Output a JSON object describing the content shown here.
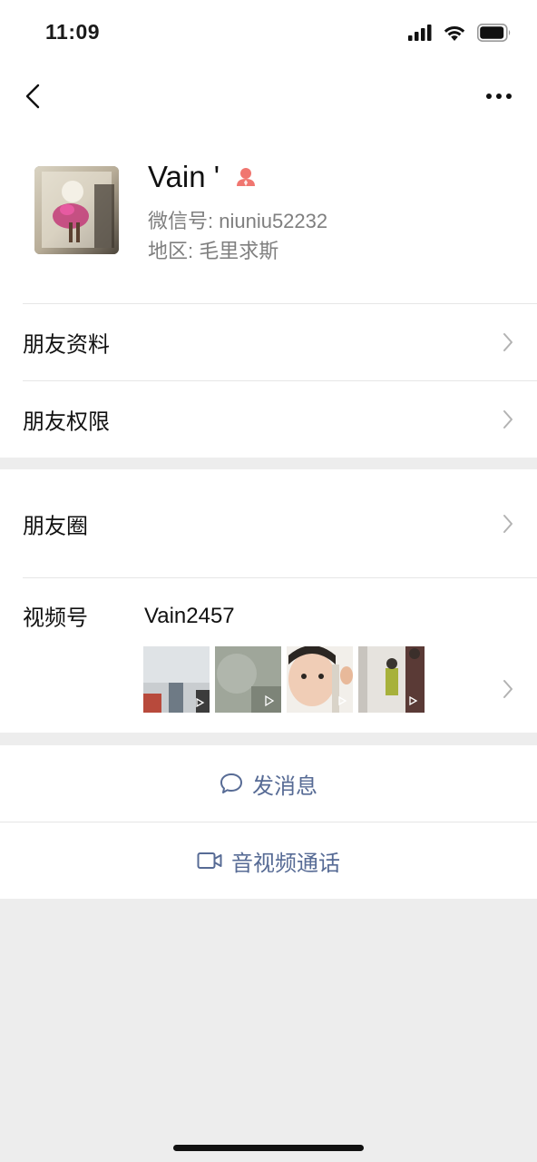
{
  "status_bar": {
    "time": "11:09"
  },
  "profile": {
    "name": "Vain ' ",
    "wechat_id": "微信号: niuniu52232",
    "region": "地区: 毛里求斯"
  },
  "menu": {
    "friend_info": "朋友资料",
    "friend_permissions": "朋友权限",
    "moments": "朋友圈",
    "channels_label": "视频号",
    "channels_name": "Vain2457"
  },
  "actions": {
    "send_message": "发消息",
    "video_call": "音视频通话"
  },
  "colors": {
    "link": "#576b95",
    "background": "#ededed",
    "contact_badge": "#f07670"
  },
  "icons": [
    "signal-icon",
    "wifi-icon",
    "battery-icon",
    "back-icon",
    "more-icon",
    "contact-badge-icon",
    "chevron-right-icon",
    "play-icon",
    "chat-bubble-icon",
    "video-camera-icon"
  ]
}
